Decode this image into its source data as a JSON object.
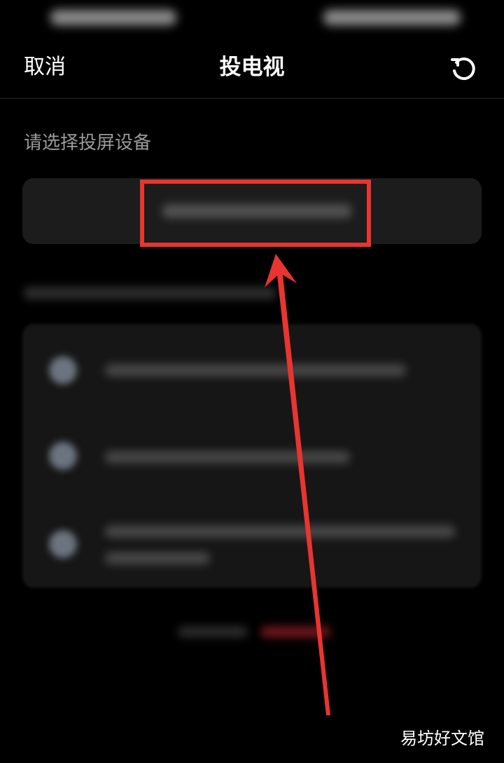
{
  "nav": {
    "cancel_label": "取消",
    "title": "投电视",
    "refresh_icon": "refresh-icon"
  },
  "section": {
    "label": "请选择投屏设备"
  },
  "colors": {
    "background": "#000000",
    "highlight": "#e8352f",
    "muted_text": "#9a9a9a",
    "card": "#1c1c1c"
  },
  "watermark": "易坊好文馆"
}
